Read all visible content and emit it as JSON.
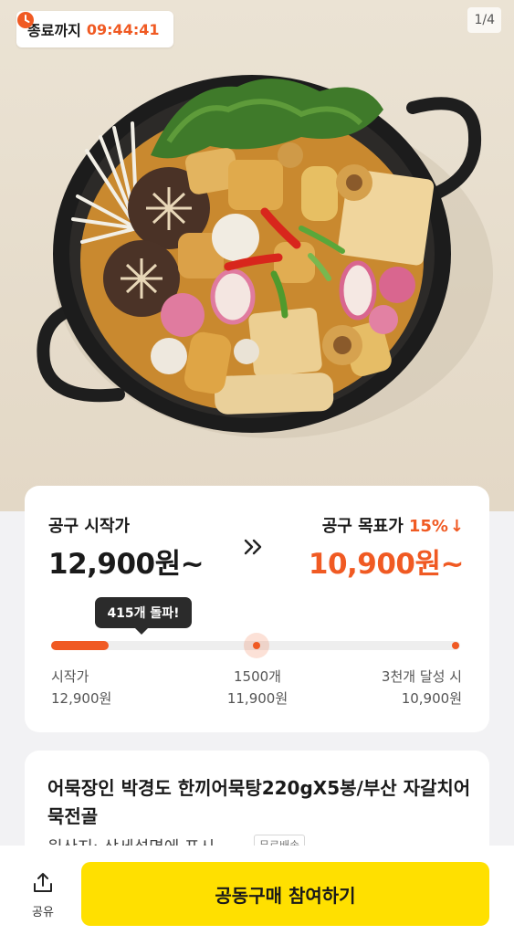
{
  "timer": {
    "label": "종료까지",
    "value": "09:44:41"
  },
  "gallery": {
    "counter": "1/4",
    "image": "fishcake-hotpot-photo"
  },
  "price": {
    "start_label": "공구 시작가",
    "start_price": "12,900원~",
    "goal_label": "공구 목표가",
    "goal_discount": "15%",
    "goal_arrow": "↓",
    "goal_price": "10,900원~",
    "progress_tooltip": "415개 돌파!",
    "progress_fraction": 0.14,
    "milestones": [
      {
        "label": "시작가",
        "price": "12,900원"
      },
      {
        "label": "1500개",
        "price": "11,900원"
      },
      {
        "label": "3천개 달성 시",
        "price": "10,900원"
      }
    ]
  },
  "product": {
    "title": "어묵장인 박경도 한끼어묵탕220gX5봉/부산 자갈치어묵전골",
    "origin": "원산지: 상세설명에 표시",
    "badge": "무료배송"
  },
  "bottom": {
    "share_label": "공유",
    "join_label": "공동구매 참여하기"
  },
  "colors": {
    "accent": "#f05a23",
    "button": "#ffe000",
    "timer_icon": "#f05a23"
  },
  "icons": {
    "timer": "clock-icon",
    "share": "share-icon",
    "arrows": "double-chevron-right-icon"
  }
}
